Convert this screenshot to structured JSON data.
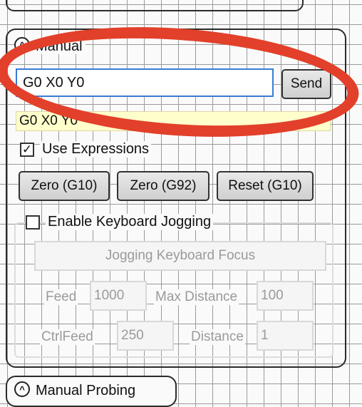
{
  "manual": {
    "title": "Manual",
    "command_value": "G0 X0 Y0",
    "send_label": "Send",
    "history_line": "G0 X0 Y0",
    "use_expressions_label": "Use Expressions",
    "use_expressions_checked": true
  },
  "buttons": {
    "zero_g10": "Zero (G10)",
    "zero_g92": "Zero (G92)",
    "reset_g10": "Reset (G10)"
  },
  "jogging": {
    "enable_label": "Enable Keyboard Jogging",
    "enable_checked": false,
    "focus_label": "Jogging Keyboard Focus",
    "feed_label": "Feed",
    "feed_value": "1000",
    "max_distance_label": "Max Distance",
    "max_distance_value": "100",
    "ctrlfeed_label": "CtrlFeed",
    "ctrlfeed_value": "250",
    "distance_label": "Distance",
    "distance_value": "1"
  },
  "next_panel": {
    "title": "Manual Probing"
  },
  "icons": {
    "collapse": "chevron-up-icon",
    "check": "checkmark-icon"
  },
  "colors": {
    "annotation": "#e2402a",
    "input_focus_border": "#3a7bd5",
    "history_bg": "#ffffcc"
  }
}
